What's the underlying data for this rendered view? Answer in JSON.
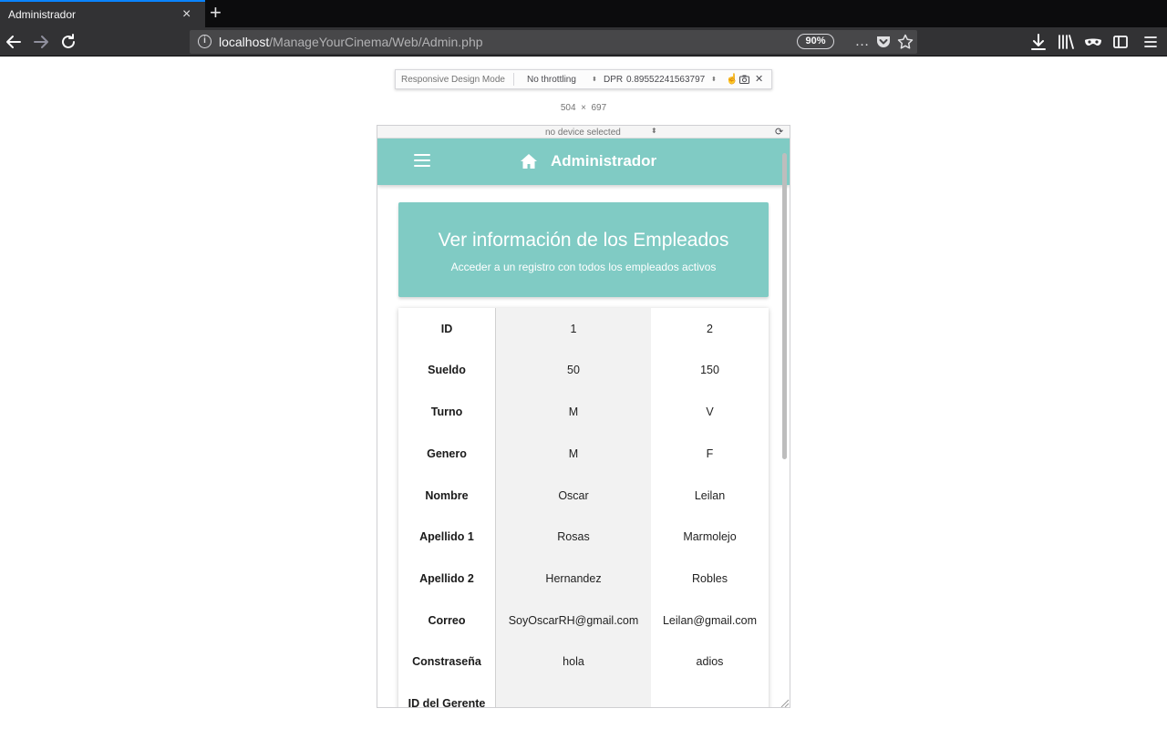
{
  "browser": {
    "tab_title": "Administrador",
    "tab_close": "×",
    "new_tab": "+",
    "url_host": "localhost",
    "url_path": "/ManageYourCinema/Web/Admin.php",
    "zoom": "90%",
    "page_actions_icon": "…"
  },
  "rdm": {
    "label": "Responsive Design Mode",
    "throttling": "No throttling",
    "dpr_label": "DPR",
    "dpr_value": "0.89552241563797",
    "width": "504",
    "times": "×",
    "height": "697",
    "device": "no device selected"
  },
  "header": {
    "title": "Administrador"
  },
  "hero": {
    "title": "Ver información de los Empleados",
    "subtitle": "Acceder a un registro con todos los empleados activos"
  },
  "table": {
    "fields": [
      "ID",
      "Sueldo",
      "Turno",
      "Genero",
      "Nombre",
      "Apellido 1",
      "Apellido 2",
      "Correo",
      "Constraseña",
      "ID del Gerente"
    ],
    "employees": [
      {
        "values": [
          "1",
          "50",
          "M",
          "M",
          "Oscar",
          "Rosas",
          "Hernandez",
          "SoyOscarRH@gmail.com",
          "hola",
          ""
        ]
      },
      {
        "values": [
          "2",
          "150",
          "V",
          "F",
          "Leilan",
          "Marmolejo",
          "Robles",
          "Leilan@gmail.com",
          "adios",
          ""
        ]
      }
    ]
  },
  "colors": {
    "accent": "#80cbc4",
    "highlight": "#0a84ff"
  }
}
